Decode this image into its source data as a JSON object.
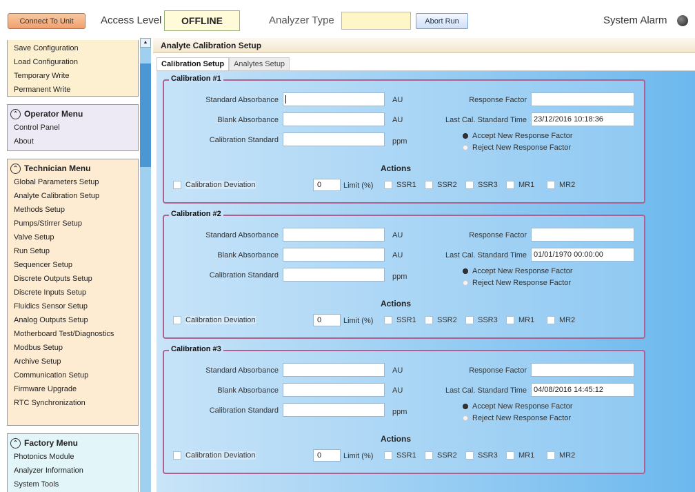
{
  "topbar": {
    "connect_label": "Connect To Unit",
    "access_label": "Access Level",
    "access_value": "OFFLINE",
    "analyzer_label": "Analyzer Type",
    "analyzer_value": "",
    "abort_label": "Abort Run",
    "alarm_label": "System Alarm",
    "alarm_icon": "alarm-led-icon"
  },
  "sidebar": {
    "file_items": [
      "Save Configuration",
      "Load Configuration",
      "Temporary Write",
      "Permanent Write"
    ],
    "operator": {
      "title": "Operator Menu",
      "items": [
        "Control Panel",
        "About"
      ]
    },
    "technician": {
      "title": "Technician Menu",
      "items": [
        "Global Parameters Setup",
        "Analyte Calibration Setup",
        "Methods Setup",
        "Pumps/Stirrer Setup",
        "Valve Setup",
        "Run Setup",
        "Sequencer Setup",
        "Discrete Outputs Setup",
        "Discrete Inputs Setup",
        "Fluidics Sensor Setup",
        "Analog Outputs Setup",
        "Motherboard Test/Diagnostics",
        "Modbus Setup",
        "Archive Setup",
        "Communication Setup",
        "Firmware Upgrade",
        "RTC Synchronization"
      ]
    },
    "factory": {
      "title": "Factory Menu",
      "items": [
        "Photonics Module",
        "Analyzer Information",
        "System Tools"
      ]
    }
  },
  "main": {
    "panel_title": "Analyte Calibration Setup",
    "tabs": [
      "Calibration Setup",
      "Analytes Setup"
    ],
    "labels": {
      "std_abs": "Standard Absorbance",
      "blank_abs": "Blank Absorbance",
      "cal_std": "Calibration Standard",
      "unit_au": "AU",
      "unit_ppm": "ppm",
      "response_factor": "Response Factor",
      "last_cal_time": "Last Cal. Standard Time",
      "accept_rf": "Accept New Response Factor",
      "reject_rf": "Reject New Response Factor",
      "actions": "Actions",
      "cal_deviation": "Calibration Deviation",
      "limit": "Limit (%)",
      "ssr1": "SSR1",
      "ssr2": "SSR2",
      "ssr3": "SSR3",
      "mr1": "MR1",
      "mr2": "MR2"
    },
    "calibrations": [
      {
        "title": "Calibration #1",
        "std_abs": "",
        "blank_abs": "",
        "cal_std": "",
        "response_factor": "",
        "last_cal_time": "23/12/2016 10:18:36",
        "limit": "0"
      },
      {
        "title": "Calibration #2",
        "std_abs": "",
        "blank_abs": "",
        "cal_std": "",
        "response_factor": "",
        "last_cal_time": "01/01/1970 00:00:00",
        "limit": "0"
      },
      {
        "title": "Calibration #3",
        "std_abs": "",
        "blank_abs": "",
        "cal_std": "",
        "response_factor": "",
        "last_cal_time": "04/08/2016 14:45:12",
        "limit": "0"
      }
    ]
  },
  "colors": {
    "accent_orange": "#f0a070",
    "border_magenta": "#b0608e",
    "content_blue": "#6cb8ee",
    "scroll_thumb": "#4b97d4"
  }
}
